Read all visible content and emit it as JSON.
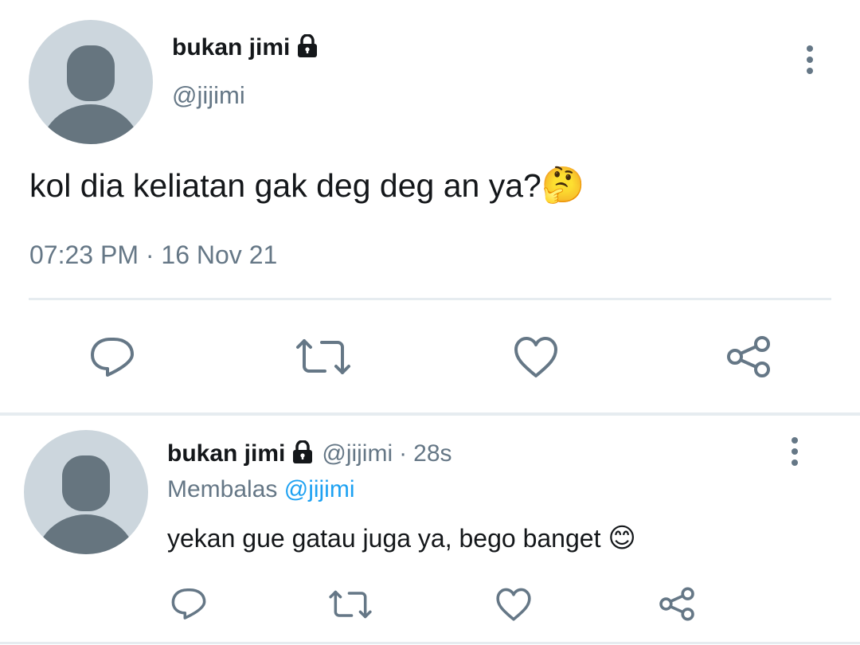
{
  "tweet": {
    "display_name": "bukan jimi",
    "handle": "@jijimi",
    "text": "kol dia keliatan gak deg deg an ya?",
    "emoji": "🤔",
    "time": "07:23 PM",
    "separator": "·",
    "date": "16 Nov 21",
    "icons": [
      "lock-icon",
      "more-vertical-icon",
      "reply-icon",
      "retweet-icon",
      "like-icon",
      "share-icon"
    ]
  },
  "reply": {
    "display_name": "bukan jimi",
    "handle": "@jijimi",
    "separator": "·",
    "time_ago": "28s",
    "replying_label": "Membalas",
    "replying_to": "@jijimi",
    "text": "yekan gue gatau juga ya, bego banget",
    "emoji": "😊"
  },
  "colors": {
    "text": "#14171a",
    "secondary": "#657786",
    "accent": "#1da1f2",
    "avatar_bg": "#ccd6dd",
    "avatar_fg": "#66757f",
    "divider": "#e6ecf0"
  }
}
